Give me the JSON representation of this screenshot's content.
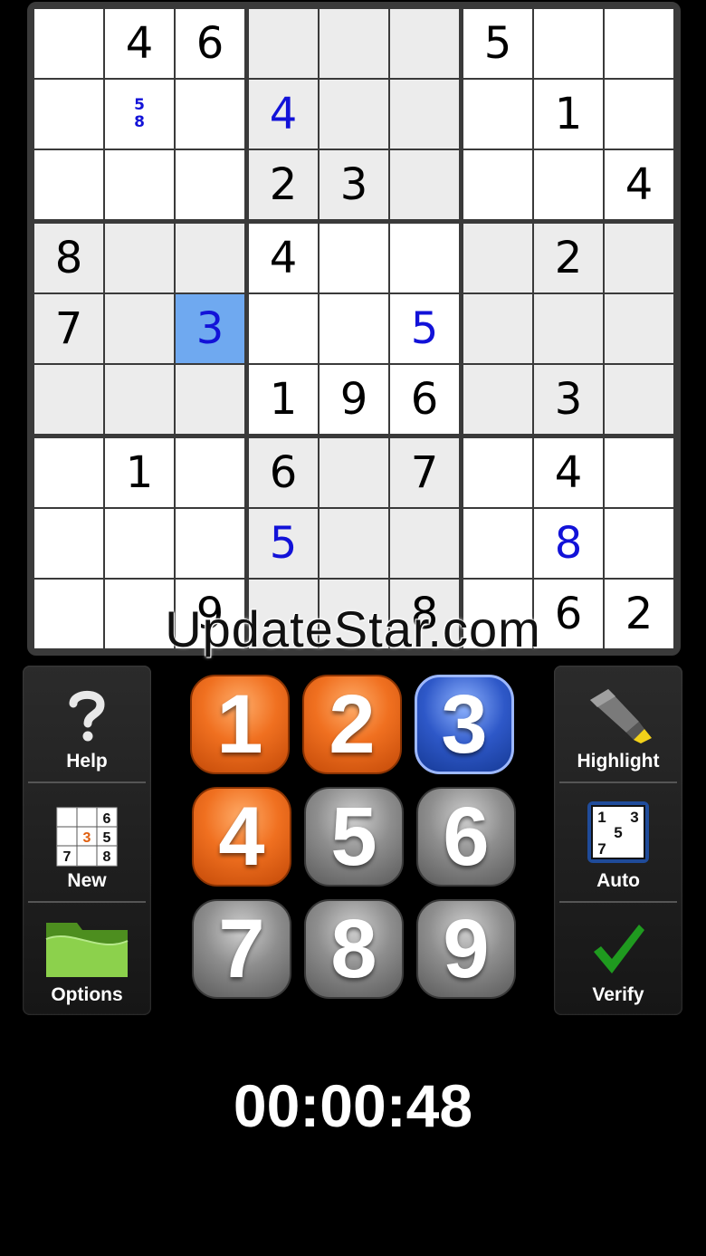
{
  "board": {
    "givens": [
      [
        "",
        "4",
        "6",
        "",
        "",
        "",
        "5",
        "",
        ""
      ],
      [
        "",
        "",
        "",
        "",
        "",
        "",
        "",
        "1",
        ""
      ],
      [
        "",
        "",
        "",
        "2",
        "3",
        "",
        "",
        "",
        "4"
      ],
      [
        "8",
        "",
        "",
        "4",
        "",
        "",
        "",
        "2",
        ""
      ],
      [
        "7",
        "",
        "",
        "",
        "",
        "",
        "",
        "",
        ""
      ],
      [
        "",
        "",
        "",
        "1",
        "9",
        "6",
        "",
        "3",
        ""
      ],
      [
        "",
        "1",
        "",
        "6",
        "",
        "7",
        "",
        "4",
        ""
      ],
      [
        "",
        "",
        "",
        "",
        "",
        "",
        "",
        "",
        ""
      ],
      [
        "",
        "",
        "9",
        "",
        "",
        "8",
        "",
        "6",
        "2"
      ]
    ],
    "entries": [
      {
        "row": 1,
        "col": 3,
        "value": "4"
      },
      {
        "row": 4,
        "col": 2,
        "value": "3"
      },
      {
        "row": 4,
        "col": 5,
        "value": "5"
      },
      {
        "row": 7,
        "col": 3,
        "value": "5"
      },
      {
        "row": 7,
        "col": 7,
        "value": "8"
      }
    ],
    "notes": [
      {
        "row": 1,
        "col": 1,
        "values": [
          "5",
          "8"
        ]
      }
    ],
    "selected": {
      "row": 4,
      "col": 2
    },
    "colors": {
      "given": "#000000",
      "entry": "#1212d8",
      "selected_bg": "#6fa9f0",
      "shade_bg": "#ececec"
    }
  },
  "watermark": "UpdateStar.com",
  "left_panel": [
    {
      "label": "Help",
      "icon": "question-mark-icon"
    },
    {
      "label": "New",
      "icon": "new-puzzle-icon",
      "icon_digits": [
        "6",
        "3",
        "5",
        "7",
        "8"
      ]
    },
    {
      "label": "Options",
      "icon": "folder-icon"
    }
  ],
  "right_panel": [
    {
      "label": "Highlight",
      "icon": "highlighter-icon"
    },
    {
      "label": "Auto",
      "icon": "auto-notes-icon",
      "icon_digits": [
        "1",
        "3",
        "5",
        "7"
      ],
      "active": true
    },
    {
      "label": "Verify",
      "icon": "checkmark-icon"
    }
  ],
  "keypad": [
    {
      "digit": "1",
      "style": "orange"
    },
    {
      "digit": "2",
      "style": "orange"
    },
    {
      "digit": "3",
      "style": "blue"
    },
    {
      "digit": "4",
      "style": "orange"
    },
    {
      "digit": "5",
      "style": "gray"
    },
    {
      "digit": "6",
      "style": "gray"
    },
    {
      "digit": "7",
      "style": "gray"
    },
    {
      "digit": "8",
      "style": "gray"
    },
    {
      "digit": "9",
      "style": "gray"
    }
  ],
  "timer": "00:00:48"
}
